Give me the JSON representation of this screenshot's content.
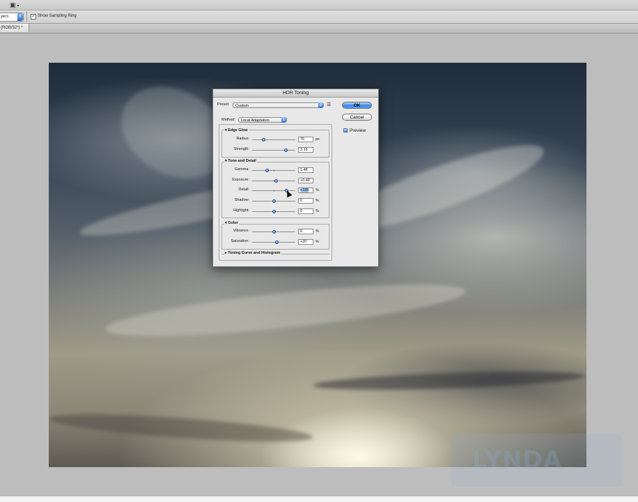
{
  "options_bar": {
    "sample_size_value": "yers",
    "show_sampling_ring_label": "Show Sampling Ring",
    "show_sampling_ring_checked": true
  },
  "document": {
    "tab_label": "(RGB/32*) *"
  },
  "dialog": {
    "title": "HDR Toning",
    "preset_label": "Preset:",
    "preset_value": "Custom",
    "method_label": "Method:",
    "method_value": "Local Adaptation",
    "ok_label": "OK",
    "cancel_label": "Cancel",
    "preview_label": "Preview",
    "preview_checked": true,
    "edge_glow": {
      "title": "Edge Glow",
      "radius": {
        "label": "Radius:",
        "value": "76",
        "unit": "px",
        "level": 0.26
      },
      "strength": {
        "label": "Strength:",
        "value": "3.15",
        "unit": "",
        "level": 0.78
      }
    },
    "tone_detail": {
      "title": "Tone and Detail",
      "gamma": {
        "label": "Gamma:",
        "value": "1.48",
        "unit": "",
        "level": 0.34
      },
      "exposure": {
        "label": "Exposure:",
        "value": "+0.48",
        "unit": "",
        "level": 0.55
      },
      "detail": {
        "label": "Detail:",
        "value": "+185",
        "unit": "%",
        "level": 0.8
      },
      "shadow": {
        "label": "Shadow:",
        "value": "0",
        "unit": "%",
        "level": 0.5
      },
      "highlight": {
        "label": "Highlight:",
        "value": "0",
        "unit": "%",
        "level": 0.5
      }
    },
    "color": {
      "title": "Color",
      "vibrance": {
        "label": "Vibrance:",
        "value": "0",
        "unit": "%",
        "level": 0.5
      },
      "saturation": {
        "label": "Saturation:",
        "value": "+20",
        "unit": "%",
        "level": 0.58
      }
    },
    "curve_section_label": "Toning Curve and Histogram"
  },
  "colors": {
    "accent": "#3b87e6",
    "dialog_bg": "#e8e8e8"
  },
  "icons": {
    "preset_menu": "list-menu-icon",
    "tool": "eyedropper-icon"
  }
}
